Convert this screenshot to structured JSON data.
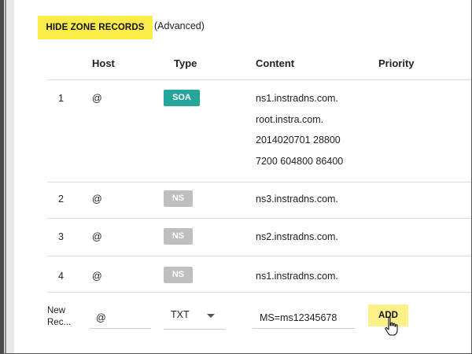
{
  "toolbar": {
    "hide_label": "HIDE ZONE RECORDS",
    "advanced_label": "(Advanced)"
  },
  "table": {
    "headers": [
      "Host",
      "Type",
      "Content",
      "Priority"
    ],
    "rows": [
      {
        "index": "1",
        "host": "@",
        "type": "SOA",
        "content": [
          "ns1.instradns.com.",
          "root.instra.com.",
          "2014020701 28800",
          "7200 604800 86400"
        ]
      },
      {
        "index": "2",
        "host": "@",
        "type": "NS",
        "content": [
          "ns3.instradns.com."
        ]
      },
      {
        "index": "3",
        "host": "@",
        "type": "NS",
        "content": [
          "ns2.instradns.com."
        ]
      },
      {
        "index": "4",
        "host": "@",
        "type": "NS",
        "content": [
          "ns1.instradns.com."
        ]
      }
    ]
  },
  "new_record": {
    "label_line1": "New",
    "label_line2": "Rec...",
    "host_value": "@",
    "type_value": "TXT",
    "content_value": "MS=ms12345678",
    "add_label": "ADD"
  },
  "icons": {
    "dropdown": "chevron-down-icon",
    "cursor": "hand-pointer-icon"
  },
  "colors": {
    "accent_yellow": "#fcec4a",
    "soa_badge": "#26a69a",
    "ns_badge": "#bfbfbf"
  }
}
